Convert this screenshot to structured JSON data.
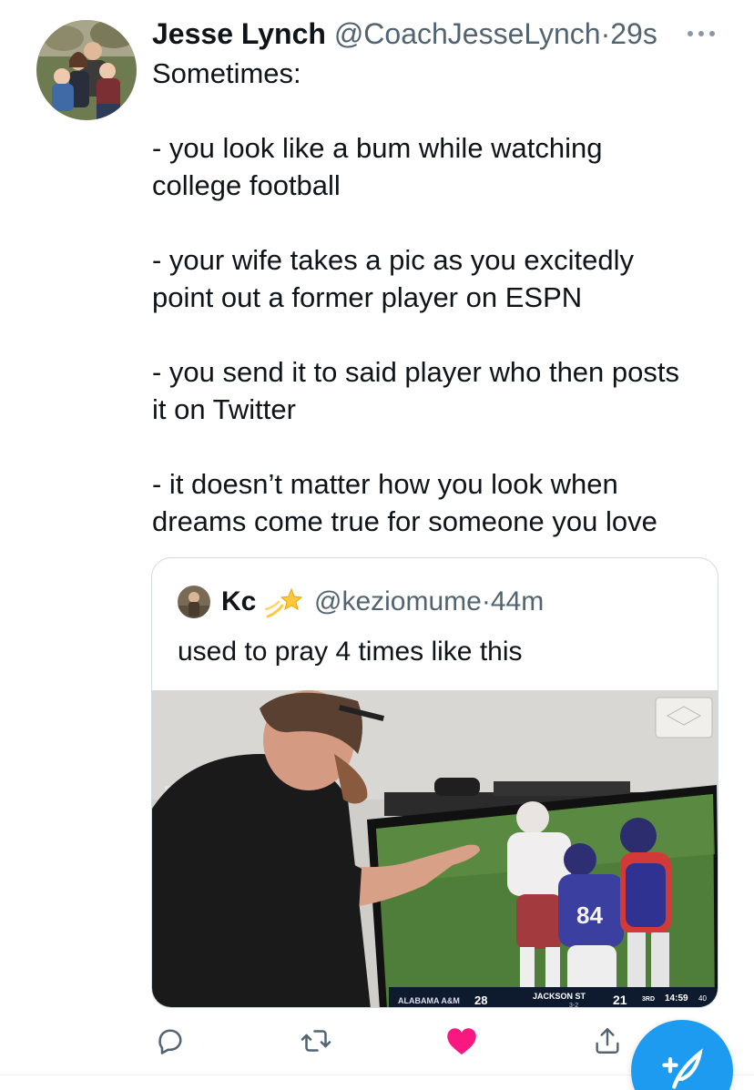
{
  "tweet": {
    "author_name": "Jesse Lynch",
    "handle": "@CoachJesseLynch",
    "separator": "·",
    "time": "29s",
    "more_icon": "ellipsis-icon",
    "lines": [
      "Sometimes:",
      "",
      "- you look like a bum while watching",
      "college football",
      "",
      "- your wife takes a pic as you excitedly",
      "point out a former player on ESPN",
      "",
      "- you send it to said player who then posts",
      "it on Twitter",
      "",
      "- it doesn’t matter how you look when",
      "dreams come true for someone you love"
    ]
  },
  "quote": {
    "author_name": "Kc",
    "emoji": "dizzy-star-emoji",
    "handle": "@keziomume",
    "separator": "·",
    "time": "44m",
    "text": "used to pray 4 times like this",
    "media": {
      "scoreboard_team_1": "ALABAMA A&M",
      "scoreboard_score_1": "28",
      "scoreboard_team_2": "JACKSON ST",
      "scoreboard_record_2": "3-2",
      "scoreboard_score_2": "21",
      "scoreboard_quarter": "3RD",
      "scoreboard_clock": "14:59",
      "scoreboard_play_clock": "40",
      "jersey_number": "84"
    }
  },
  "actions": {
    "reply_icon": "reply-icon",
    "retweet_icon": "retweet-icon",
    "like_icon": "heart-icon",
    "share_icon": "share-icon",
    "compose_icon": "compose-tweet-icon"
  },
  "colors": {
    "accent": "#1d9bf0",
    "like": "#f91880",
    "secondary_text": "#536471"
  }
}
